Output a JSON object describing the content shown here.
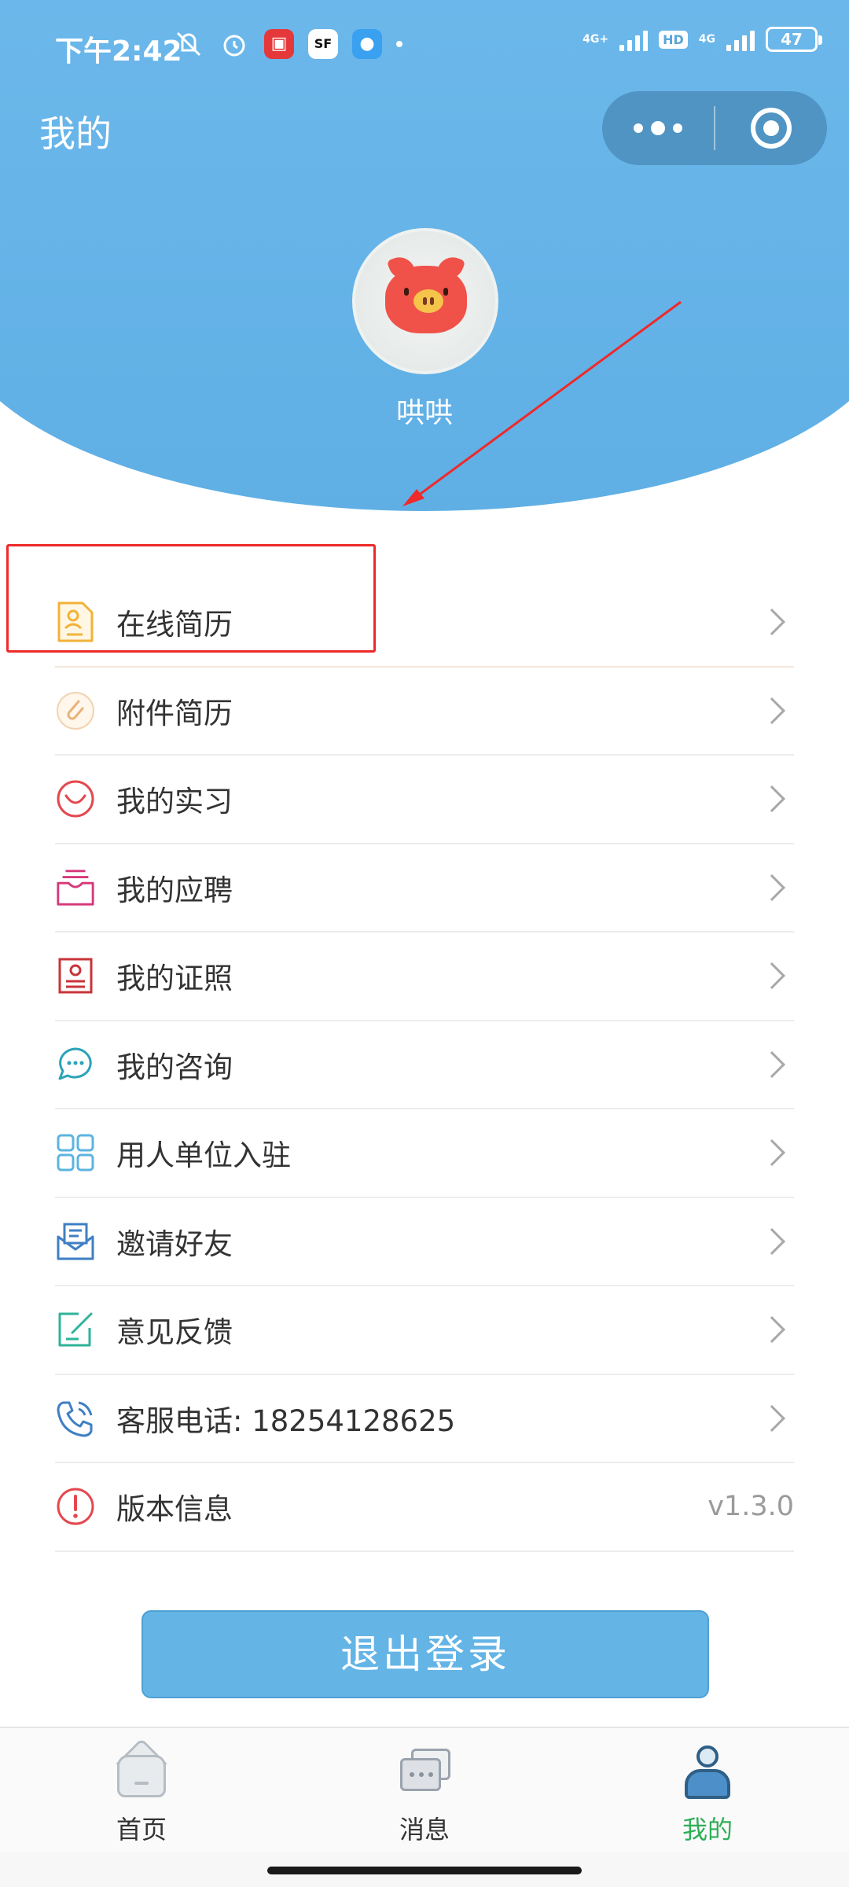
{
  "status_bar": {
    "time": "下午2:42",
    "battery": "47",
    "network_1": "4G+",
    "network_2": "4G",
    "hd_label": "HD"
  },
  "header": {
    "title": "我的"
  },
  "profile": {
    "username": "哄哄"
  },
  "menu": {
    "items": [
      {
        "label": "在线简历",
        "icon": "resume-icon"
      },
      {
        "label": "附件简历",
        "icon": "attachment-icon"
      },
      {
        "label": "我的实习",
        "icon": "internship-icon"
      },
      {
        "label": "我的应聘",
        "icon": "application-icon"
      },
      {
        "label": "我的证照",
        "icon": "certificate-icon"
      },
      {
        "label": "我的咨询",
        "icon": "consult-icon"
      },
      {
        "label": "用人单位入驻",
        "icon": "employer-icon"
      },
      {
        "label": "邀请好友",
        "icon": "invite-icon"
      },
      {
        "label": "意见反馈",
        "icon": "feedback-icon"
      },
      {
        "label": "客服电话: 18254128625",
        "icon": "phone-icon"
      },
      {
        "label": "版本信息",
        "icon": "info-icon",
        "value": "v1.3.0"
      }
    ]
  },
  "logout_label": "退出登录",
  "tabbar": {
    "tabs": [
      {
        "label": "首页",
        "icon": "home-icon"
      },
      {
        "label": "消息",
        "icon": "message-icon"
      },
      {
        "label": "我的",
        "icon": "profile-icon",
        "active": true
      }
    ]
  },
  "colors": {
    "header_blue": "#5aa5da",
    "active_tab": "#2fae57",
    "annotation_red": "#ee2a2a",
    "logout_button": "#64b4e6"
  }
}
